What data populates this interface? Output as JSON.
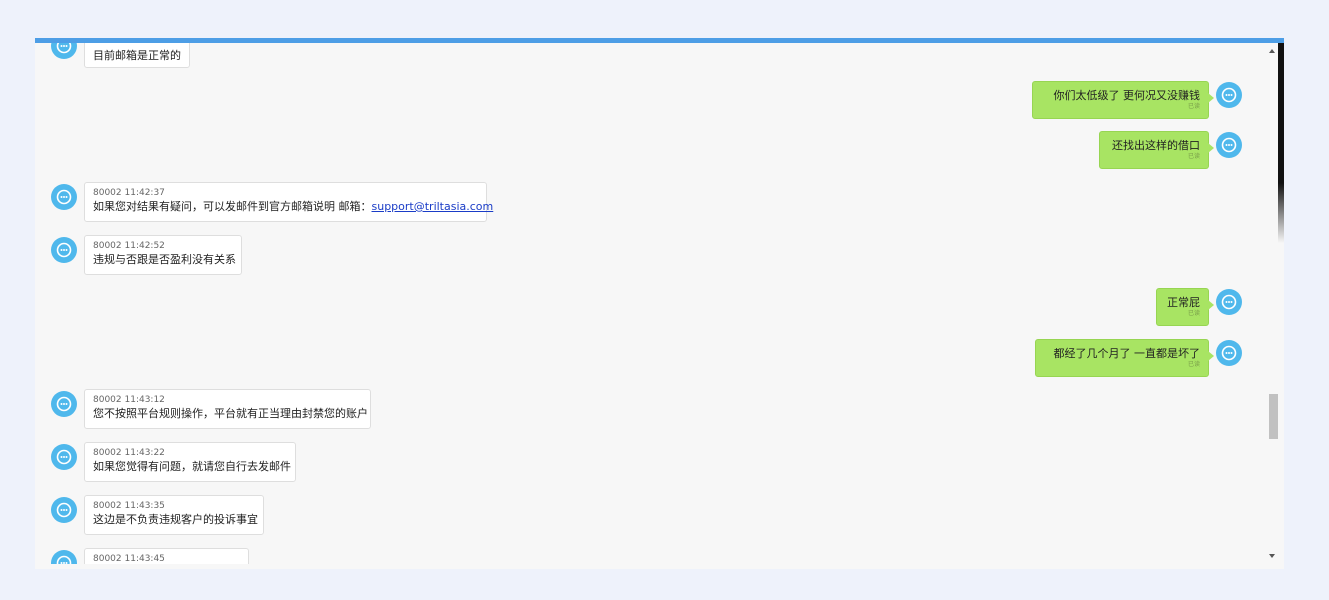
{
  "messages": {
    "m0": {
      "text": "目前邮箱是正常的"
    },
    "m1": {
      "text": "你们太低级了   更何况又没赚钱",
      "read": "已读"
    },
    "m2": {
      "text": "还找出这样的借口",
      "read": "已读"
    },
    "m3": {
      "meta": "80002 11:42:37",
      "text": "如果您对结果有疑问，可以发邮件到官方邮箱说明 邮箱：",
      "link": "support@triltasia.com"
    },
    "m4": {
      "meta": "80002 11:42:52",
      "text": "违规与否跟是否盈利没有关系"
    },
    "m5": {
      "text": "正常屁",
      "read": "已读"
    },
    "m6": {
      "text": "都经了几个月了  一直都是坏了",
      "read": "已读"
    },
    "m7": {
      "meta": "80002 11:43:12",
      "text": "您不按照平台规则操作，平台就有正当理由封禁您的账户"
    },
    "m8": {
      "meta": "80002 11:43:22",
      "text": "如果您觉得有问题，就请您自行去发邮件"
    },
    "m9": {
      "meta": "80002 11:43:35",
      "text": "这边是不负责违规客户的投诉事宜"
    },
    "m10": {
      "meta": "80002 11:43:45"
    }
  },
  "icons": {
    "agent": "headset-avatar-icon",
    "user": "headset-avatar-icon"
  },
  "colors": {
    "accent": "#4d9ee6",
    "sent_bubble": "#a8e463",
    "avatar": "#4fb8ec"
  }
}
